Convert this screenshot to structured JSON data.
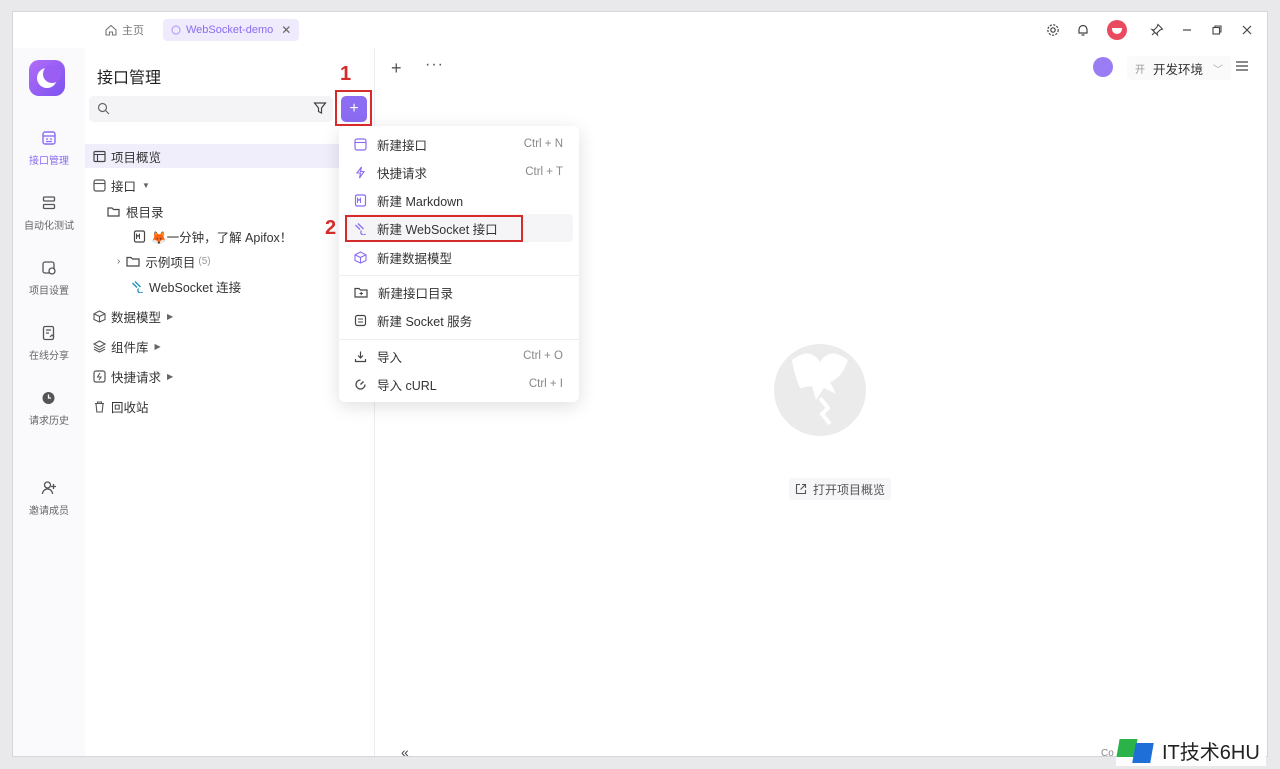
{
  "titlebar": {
    "tabs": [
      {
        "label": "主页"
      },
      {
        "label": "WebSocket-demo",
        "close": "✕"
      }
    ]
  },
  "rail": {
    "items": [
      {
        "label": "接口管理",
        "icon": "api-icon"
      },
      {
        "label": "自动化测试",
        "icon": "automation-icon"
      },
      {
        "label": "项目设置",
        "icon": "project-settings-icon"
      },
      {
        "label": "在线分享",
        "icon": "share-icon"
      },
      {
        "label": "请求历史",
        "icon": "history-icon"
      },
      {
        "label": "邀请成员",
        "icon": "invite-icon"
      }
    ]
  },
  "panel": {
    "title": "接口管理",
    "search_placeholder": "",
    "tree": [
      {
        "label": "项目概览"
      },
      {
        "label": "接口"
      },
      {
        "label": "根目录"
      },
      {
        "label": "🦊一分钟，了解 Apifox！"
      },
      {
        "label": "示例项目",
        "count": "(5)"
      },
      {
        "label": "WebSocket 连接"
      },
      {
        "label": "数据模型"
      },
      {
        "label": "组件库"
      },
      {
        "label": "快捷请求"
      },
      {
        "label": "回收站"
      }
    ]
  },
  "menu": {
    "items": [
      {
        "label": "新建接口",
        "shortcut": "Ctrl + N"
      },
      {
        "label": "快捷请求",
        "shortcut": "Ctrl + T"
      },
      {
        "label": "新建 Markdown",
        "shortcut": ""
      },
      {
        "label": "新建 WebSocket 接口",
        "shortcut": ""
      },
      {
        "label": "新建数据模型",
        "shortcut": ""
      },
      {
        "label": "新建接口目录",
        "shortcut": ""
      },
      {
        "label": "新建 Socket 服务",
        "shortcut": ""
      },
      {
        "label": "导入",
        "shortcut": "Ctrl + O"
      },
      {
        "label": "导入 cURL",
        "shortcut": "Ctrl + I"
      }
    ]
  },
  "main": {
    "env_tag": "开",
    "env_label": "开发环境",
    "open_overview": "打开项目概览",
    "collapse": "«",
    "footer_hint": "Co"
  },
  "annotations": {
    "step1": "1",
    "step2": "2"
  },
  "watermark": {
    "text": "IT技术6HU"
  },
  "colors": {
    "accent": "#8b6cf2",
    "annotation": "#d62b2b"
  }
}
